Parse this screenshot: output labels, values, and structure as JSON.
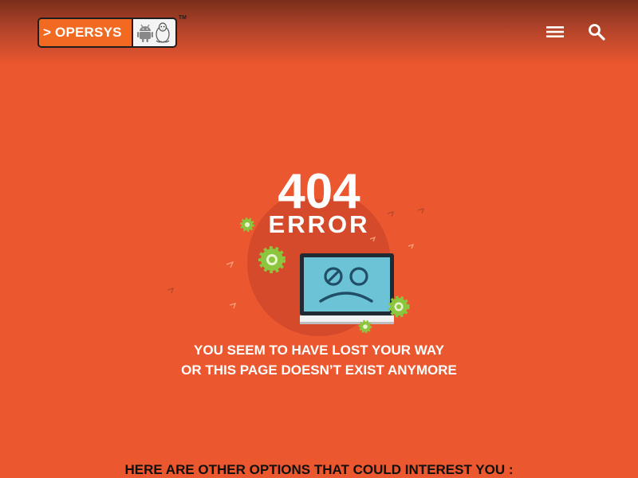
{
  "header": {
    "logo": {
      "text": "> OPERSYS",
      "trademark": "TM",
      "icons": [
        "android-icon",
        "linux-penguin-icon"
      ]
    },
    "menu_icon": "menu-icon",
    "search_icon": "search-icon"
  },
  "error": {
    "code": "404",
    "label": "ERROR",
    "message_line1": "YOU SEEM TO HAVE LOST YOUR WAY",
    "message_line2": "OR THIS PAGE DOESN’T EXIST ANYMORE"
  },
  "options": {
    "heading": "HERE ARE OTHER OPTIONS THAT COULD INTEREST YOU :"
  },
  "colors": {
    "background": "#eb572f",
    "logo_orange": "#f26a22",
    "gear_green": "#8cc63f",
    "screen_blue": "#5bc0de"
  }
}
